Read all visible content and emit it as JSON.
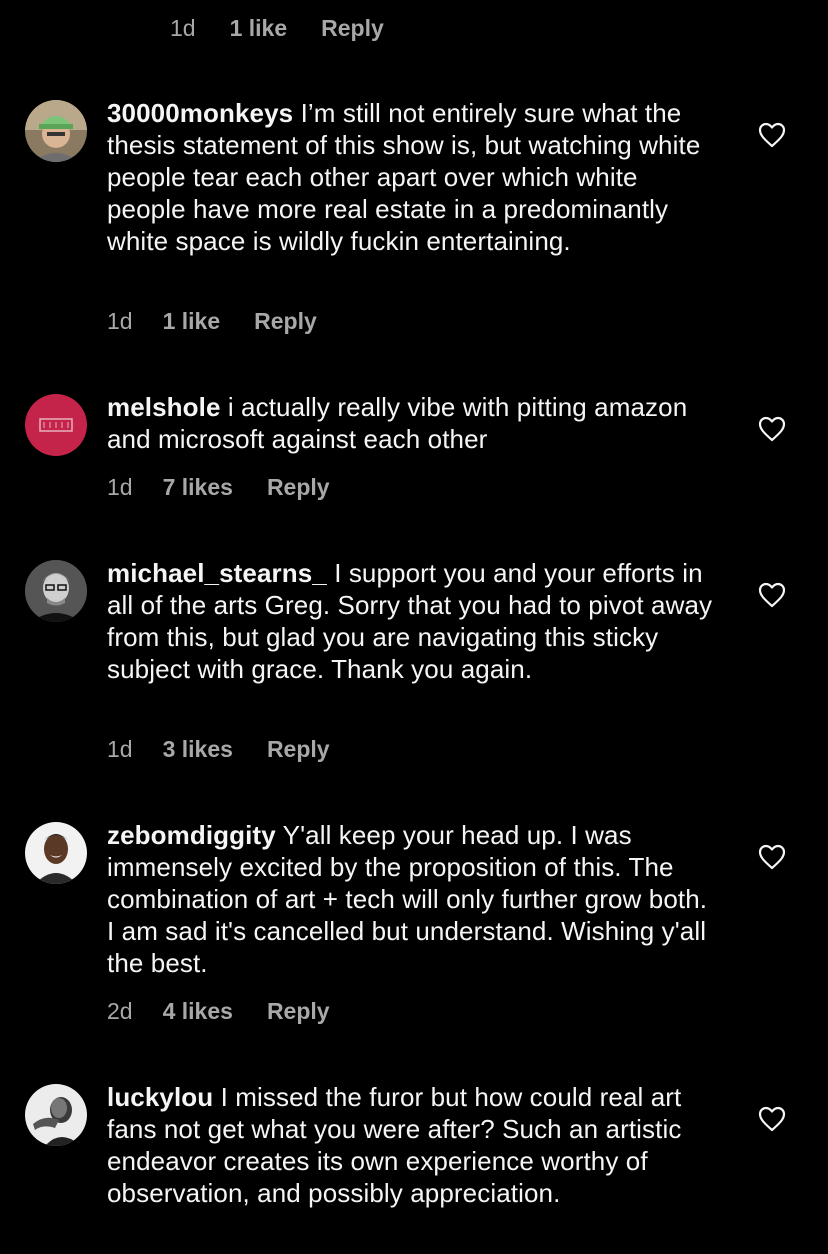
{
  "top_meta": {
    "time": "1d",
    "likes": "1 like",
    "reply": "Reply"
  },
  "colors": {
    "background": "#000000",
    "text": "#f5f5f5",
    "secondary": "#a8a8a8"
  },
  "comments": [
    {
      "username": "30000monkeys",
      "text": "I’m still not entirely sure what the thesis statement of this show is, but watching white people tear each other apart over which white people have more real estate in a predominantly white space is wildly fuckin entertaining.",
      "time": "1d",
      "likes": "1 like",
      "reply": "Reply",
      "avatar_icon": "user-avatar-green-cap"
    },
    {
      "username": "melshole",
      "text": "i actually really vibe with pitting amazon and microsoft against each other",
      "time": "1d",
      "likes": "7 likes",
      "reply": "Reply",
      "avatar_icon": "user-avatar-pink"
    },
    {
      "username": "michael_stearns_",
      "text": "I support you and your efforts in all of the arts Greg. Sorry that you had to pivot away from this, but glad you are navigating this sticky subject with grace. Thank you again.",
      "time": "1d",
      "likes": "3 likes",
      "reply": "Reply",
      "avatar_icon": "user-avatar-bw-portrait"
    },
    {
      "username": "zebomdiggity",
      "text": "Y'all keep your head up. I was immensely excited by the proposition of this. The combination of art + tech will only further grow both. I am sad it's cancelled but understand. Wishing y'all the best.",
      "time": "2d",
      "likes": "4 likes",
      "reply": "Reply",
      "avatar_icon": "user-avatar-portrait"
    },
    {
      "username": "luckylou",
      "text": "I missed the furor but how could real art fans not get what you were after? Such an artistic endeavor creates its own experience worthy of observation, and possibly appreciation.",
      "avatar_icon": "user-avatar-bw-profile"
    }
  ]
}
